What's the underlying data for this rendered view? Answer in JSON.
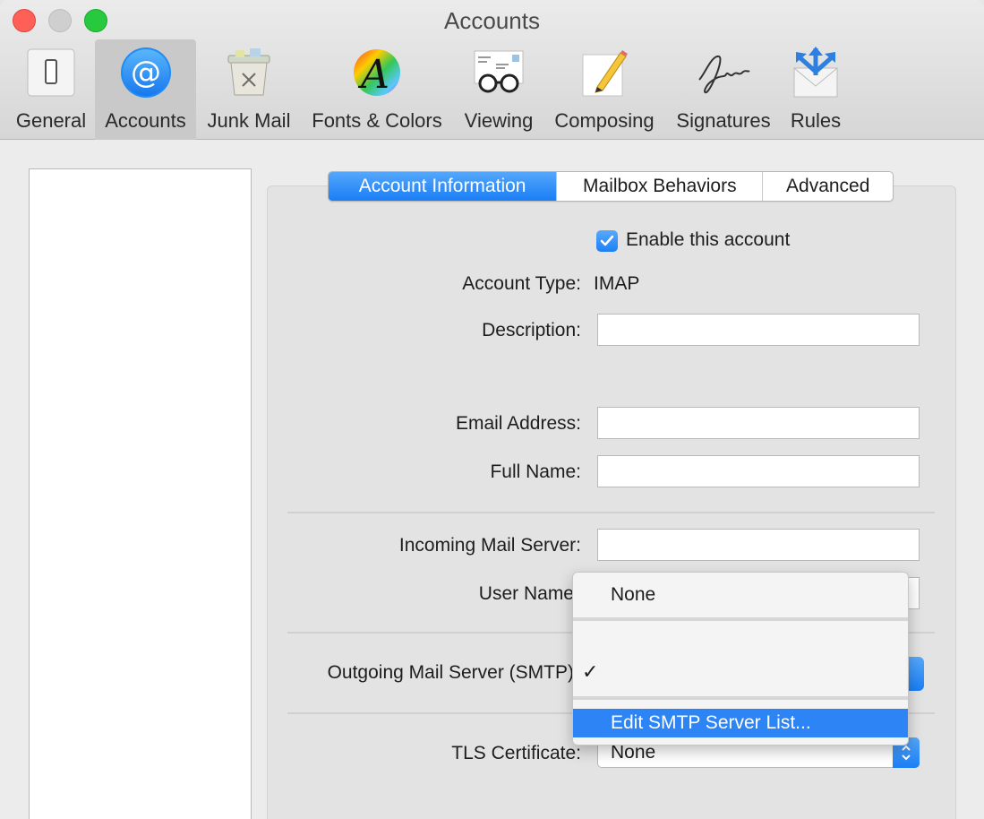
{
  "window": {
    "title": "Accounts"
  },
  "toolbar": {
    "items": [
      {
        "label": "General",
        "icon": "general-icon"
      },
      {
        "label": "Accounts",
        "icon": "accounts-icon",
        "selected": true
      },
      {
        "label": "Junk Mail",
        "icon": "junk-mail-icon"
      },
      {
        "label": "Fonts & Colors",
        "icon": "fonts-colors-icon"
      },
      {
        "label": "Viewing",
        "icon": "viewing-icon"
      },
      {
        "label": "Composing",
        "icon": "composing-icon"
      },
      {
        "label": "Signatures",
        "icon": "signatures-icon"
      },
      {
        "label": "Rules",
        "icon": "rules-icon"
      }
    ]
  },
  "tabs": [
    {
      "label": "Account Information",
      "active": true
    },
    {
      "label": "Mailbox Behaviors"
    },
    {
      "label": "Advanced"
    }
  ],
  "form": {
    "enable_label": "Enable this account",
    "enable_checked": true,
    "account_type_label": "Account Type:",
    "account_type_value": "IMAP",
    "description_label": "Description:",
    "description_value": "",
    "email_label": "Email Address:",
    "email_value": "",
    "full_name_label": "Full Name:",
    "full_name_value": "",
    "incoming_label": "Incoming Mail Server:",
    "incoming_value": "",
    "username_label": "User Name",
    "outgoing_label": "Outgoing Mail Server (SMTP)",
    "tls_label": "TLS Certificate:",
    "tls_value": "None"
  },
  "smtp_menu": {
    "items": [
      "None",
      "",
      "Edit SMTP Server List..."
    ],
    "checked_index": 1,
    "checkmark": "✓"
  },
  "colors": {
    "accent": "#1a7ef5",
    "highlight": "#2d84f5"
  }
}
